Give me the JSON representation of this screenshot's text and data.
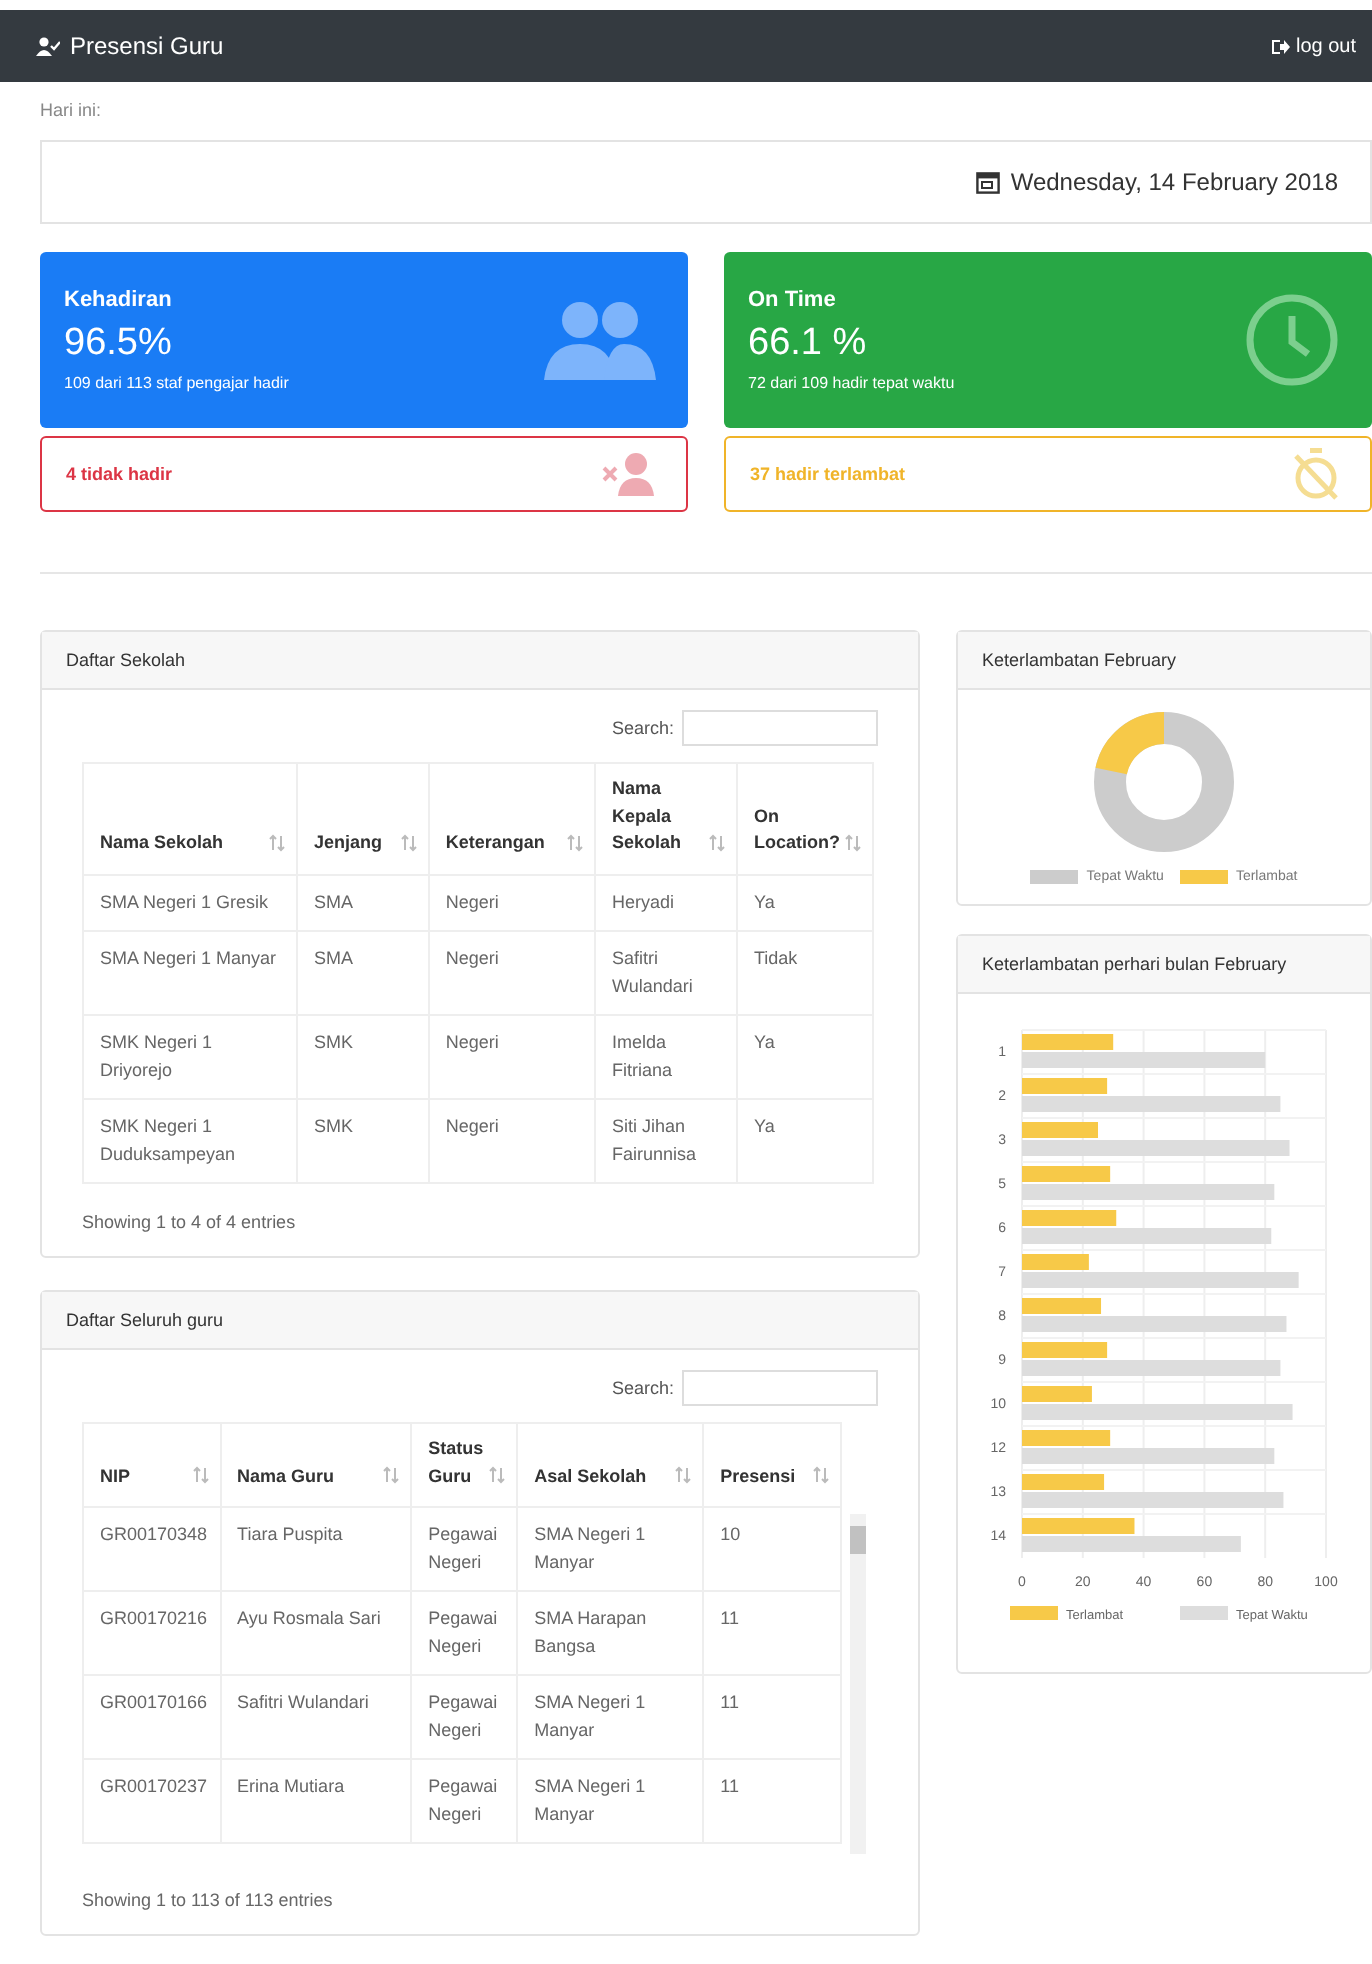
{
  "navbar": {
    "title": "Presensi Guru",
    "logout": "log out"
  },
  "today_label": "Hari ini:",
  "date": "Wednesday, 14 February 2018",
  "stat_cards": [
    {
      "kind": "people",
      "color": "#1a7cf5",
      "title": "Kehadiran",
      "value": "96.5%",
      "caption": "109 dari 113 staf pengajar hadir"
    },
    {
      "kind": "clock",
      "color": "#28a745",
      "title": "On Time",
      "value": "66.1 %",
      "caption": "72 dari 109 hadir tepat waktu"
    }
  ],
  "alert_cards": [
    {
      "kind": "absent",
      "color": "#dc3545",
      "text": "4 tidak hadir"
    },
    {
      "kind": "late",
      "color": "#f0b429",
      "text": "37 hadir terlambat"
    }
  ],
  "schools": {
    "title": "Daftar Sekolah",
    "search_label": "Search:",
    "columns": [
      "Nama Sekolah",
      "Jenjang",
      "Keterangan",
      "Nama Kepala Sekolah",
      "On Location?"
    ],
    "rows": [
      [
        "SMA Negeri 1 Gresik",
        "SMA",
        "Negeri",
        "Heryadi",
        "Ya"
      ],
      [
        "SMA Negeri 1 Manyar",
        "SMA",
        "Negeri",
        "Safitri Wulandari",
        "Tidak"
      ],
      [
        "SMK Negeri 1 Driyorejo",
        "SMK",
        "Negeri",
        "Imelda Fitriana",
        "Ya"
      ],
      [
        "SMK Negeri 1 Duduksampeyan",
        "SMK",
        "Negeri",
        "Siti Jihan Fairunnisa",
        "Ya"
      ]
    ],
    "info": "Showing 1 to 4 of 4 entries"
  },
  "teachers": {
    "title": "Daftar Seluruh guru",
    "search_label": "Search:",
    "columns": [
      "NIP",
      "Nama Guru",
      "Status Guru",
      "Asal Sekolah",
      "Presensi"
    ],
    "rows": [
      [
        "GR00170348",
        "Tiara Puspita",
        "Pegawai Negeri",
        "SMA Negeri 1 Manyar",
        "10"
      ],
      [
        "GR00170216",
        "Ayu Rosmala Sari",
        "Pegawai Negeri",
        "SMA Harapan Bangsa",
        "11"
      ],
      [
        "GR00170166",
        "Safitri Wulandari",
        "Pegawai Negeri",
        "SMA Negeri 1 Manyar",
        "11"
      ],
      [
        "GR00170237",
        "Erina Mutiara",
        "Pegawai Negeri",
        "SMA Negeri 1 Manyar",
        "11"
      ]
    ],
    "info": "Showing 1 to 113 of 113 entries"
  },
  "donut_panel": {
    "title": "Keterlambatan February",
    "legend": [
      {
        "label": "Tepat Waktu",
        "color": "#cccccc"
      },
      {
        "label": "Terlambat",
        "color": "#f7c948"
      }
    ]
  },
  "bar_panel": {
    "title": "Keterlambatan perhari bulan February",
    "chart_data": {
      "type": "bar",
      "orientation": "horizontal",
      "grid": true,
      "legend": true,
      "categories": [
        "1",
        "2",
        "3",
        "5",
        "6",
        "7",
        "8",
        "9",
        "10",
        "12",
        "13",
        "14"
      ],
      "xlim": [
        0,
        100
      ],
      "xticks": [
        0,
        20,
        40,
        60,
        80,
        100
      ],
      "series": [
        {
          "name": "Terlambat",
          "color": "#f7c948",
          "values": [
            30,
            28,
            25,
            29,
            31,
            22,
            26,
            28,
            23,
            29,
            27,
            37
          ]
        },
        {
          "name": "Tepat Waktu",
          "color": "#dddddd",
          "values": [
            80,
            85,
            88,
            83,
            82,
            91,
            87,
            85,
            89,
            83,
            86,
            72
          ]
        }
      ]
    }
  }
}
